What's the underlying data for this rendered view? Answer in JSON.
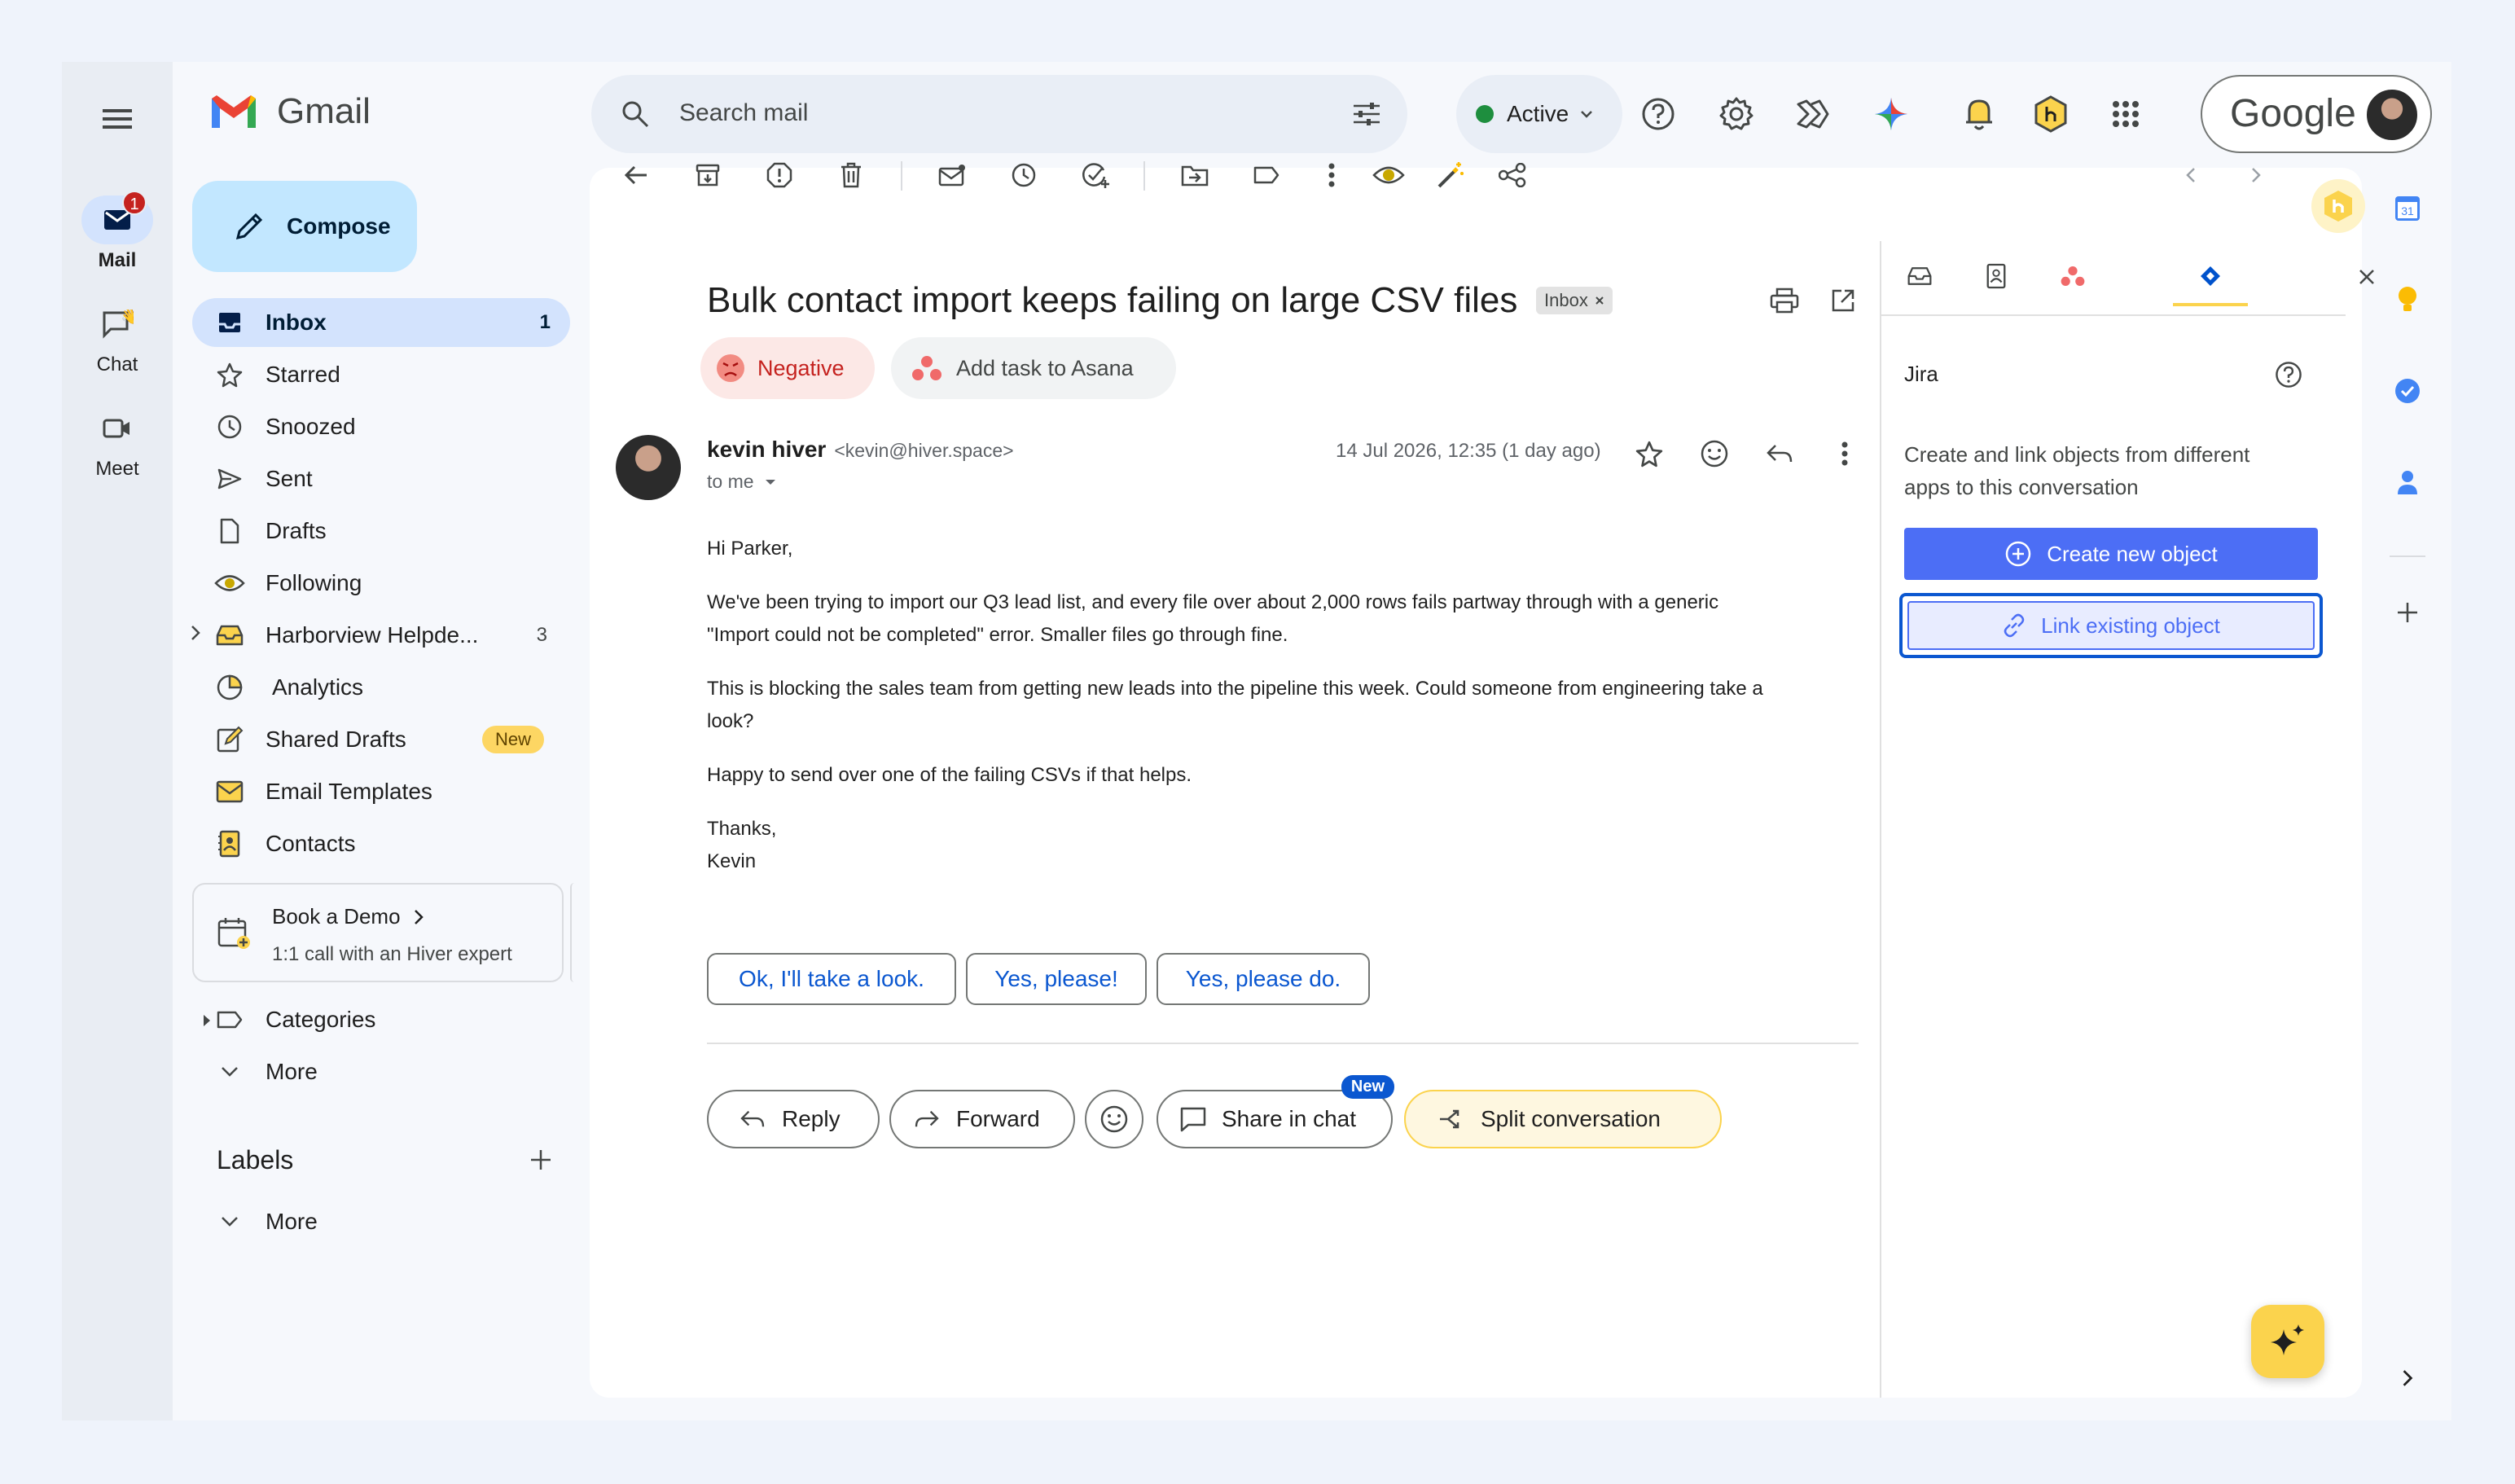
{
  "rail": {
    "mail_label": "Mail",
    "mail_badge": "1",
    "chat_label": "Chat",
    "meet_label": "Meet"
  },
  "brand": {
    "name": "Gmail"
  },
  "compose_label": "Compose",
  "nav": [
    {
      "label": "Inbox",
      "count": "1"
    },
    {
      "label": "Starred"
    },
    {
      "label": "Snoozed"
    },
    {
      "label": "Sent"
    },
    {
      "label": "Drafts"
    },
    {
      "label": "Following"
    },
    {
      "label": "Harborview Helpde...",
      "count": "3"
    },
    {
      "label": "Analytics"
    },
    {
      "label": "Shared Drafts",
      "badge": "New"
    },
    {
      "label": "Email Templates"
    },
    {
      "label": "Contacts"
    }
  ],
  "demo": {
    "title": "Book a Demo",
    "subtitle": "1:1 call with an Hiver expert"
  },
  "nav_bottom": {
    "categories": "Categories",
    "more": "More"
  },
  "labels": {
    "heading": "Labels",
    "more": "More"
  },
  "search": {
    "placeholder": "Search mail"
  },
  "status": {
    "label": "Active",
    "color": "#1e8e3e"
  },
  "google_label": "Google",
  "email": {
    "subject": "Bulk contact import keeps failing on large CSV files",
    "label_chip": "Inbox",
    "sentiment": "Negative",
    "asana": "Add task to Asana",
    "sender_name": "kevin hiver",
    "sender_email": "<kevin@hiver.space>",
    "to": "to me",
    "date": "14 Jul 2026, 12:35 (1 day ago)",
    "greeting": "Hi Parker,",
    "p1_line1": "We've been trying to import our Q3 lead list, and every file over about 2,000 rows fails partway through with a generic",
    "p1_line2": "\"Import could not be completed\" error. Smaller files go through fine.",
    "p2_line1": "This is blocking the sales team from getting new leads into the pipeline this week. Could someone from engineering take a",
    "p2_line2": "look?",
    "p3": "Happy to send over one of the failing CSVs if that helps.",
    "signoff": "Thanks,",
    "signature": "Kevin"
  },
  "smart_replies": [
    "Ok, I'll take a look.",
    "Yes, please!",
    "Yes, please do."
  ],
  "actions": {
    "reply": "Reply",
    "forward": "Forward",
    "share": "Share in chat",
    "share_badge": "New",
    "split": "Split conversation"
  },
  "panel": {
    "title": "Jira",
    "desc_line1": "Create and link objects from different",
    "desc_line2": "apps to this conversation",
    "create": "Create new object",
    "link": "Link existing object"
  },
  "right_rail": {
    "calendar_day": "31"
  },
  "colors": {
    "accent": "#0b57d0",
    "hiver_yellow": "#fbd34d",
    "negative": "#fce8e6",
    "jira_blue": "#4c6ef5"
  }
}
